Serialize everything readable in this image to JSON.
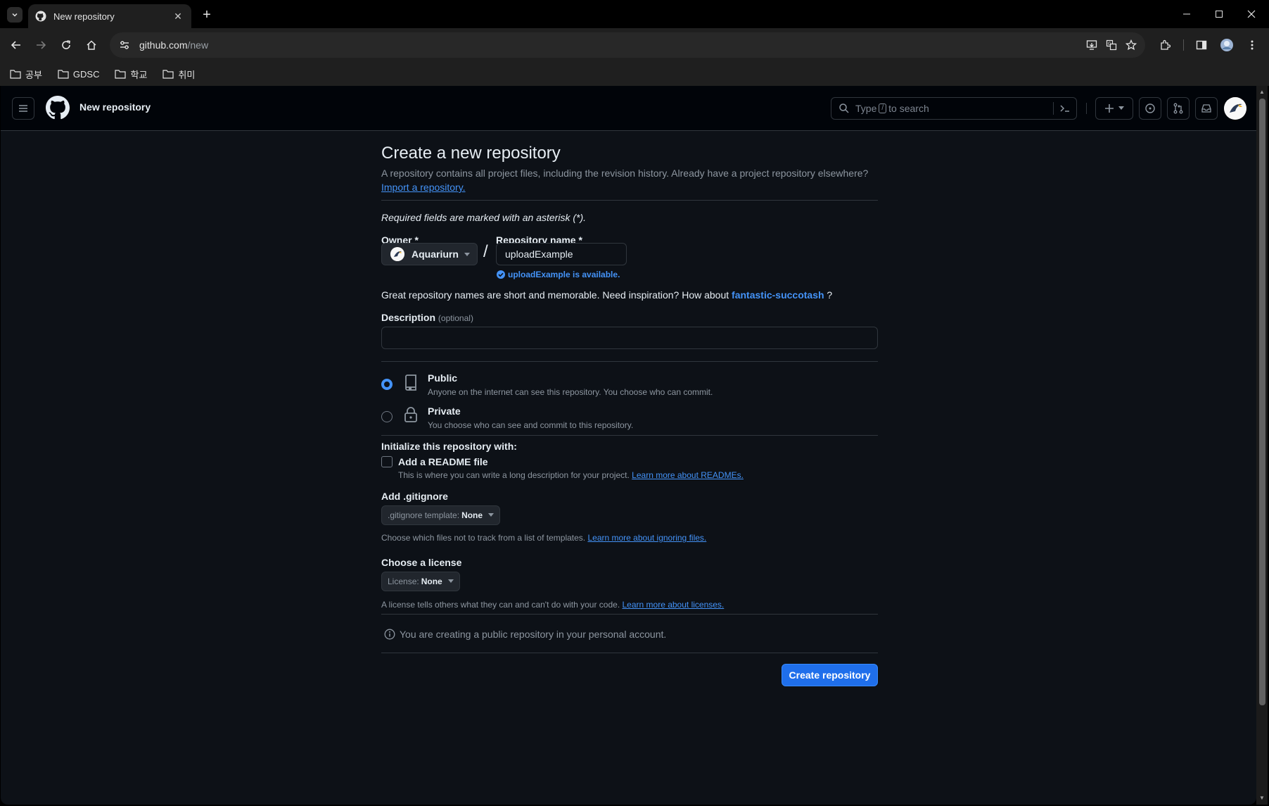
{
  "browser": {
    "tab_title": "New repository",
    "url_host": "github.com",
    "url_path": "/new",
    "bookmarks": [
      "공부",
      "GDSC",
      "학교",
      "취미"
    ]
  },
  "header": {
    "context": "New repository",
    "search_prefix": "Type",
    "search_key": "/",
    "search_suffix": "to search"
  },
  "form": {
    "title": "Create a new repository",
    "lead": "A repository contains all project files, including the revision history. Already have a project repository elsewhere?",
    "import_link": "Import a repository.",
    "required_note": "Required fields are marked with an asterisk (*).",
    "owner_label": "Owner *",
    "owner_value": "Aquariurn",
    "repo_label": "Repository name *",
    "repo_value": "uploadExample",
    "slash": "/",
    "availability": "uploadExample is available.",
    "inspiration": "Great repository names are short and memorable. Need inspiration? How about",
    "suggestion": "fantastic-succotash",
    "inspiration_end": "?",
    "description_label": "Description",
    "description_optional": "(optional)",
    "description_value": "",
    "visibility": [
      {
        "title": "Public",
        "desc": "Anyone on the internet can see this repository. You choose who can commit.",
        "selected": true
      },
      {
        "title": "Private",
        "desc": "You choose who can see and commit to this repository.",
        "selected": false
      }
    ],
    "init_label": "Initialize this repository with:",
    "readme_label": "Add a README file",
    "readme_desc": "This is where you can write a long description for your project.",
    "readme_link": "Learn more about READMEs.",
    "gitignore_label": "Add .gitignore",
    "gitignore_btn_prefix": ".gitignore template:",
    "gitignore_btn_value": "None",
    "gitignore_desc": "Choose which files not to track from a list of templates.",
    "gitignore_link": "Learn more about ignoring files.",
    "license_label": "Choose a license",
    "license_btn_prefix": "License:",
    "license_btn_value": "None",
    "license_desc": "A license tells others what they can and can't do with your code.",
    "license_link": "Learn more about licenses.",
    "notice": "You are creating a public repository in your personal account.",
    "submit": "Create repository"
  },
  "colors": {
    "page_bg": "#0d1117",
    "header_bg": "#010409",
    "accent": "#4493f8",
    "primary_button": "#1f6feb"
  }
}
